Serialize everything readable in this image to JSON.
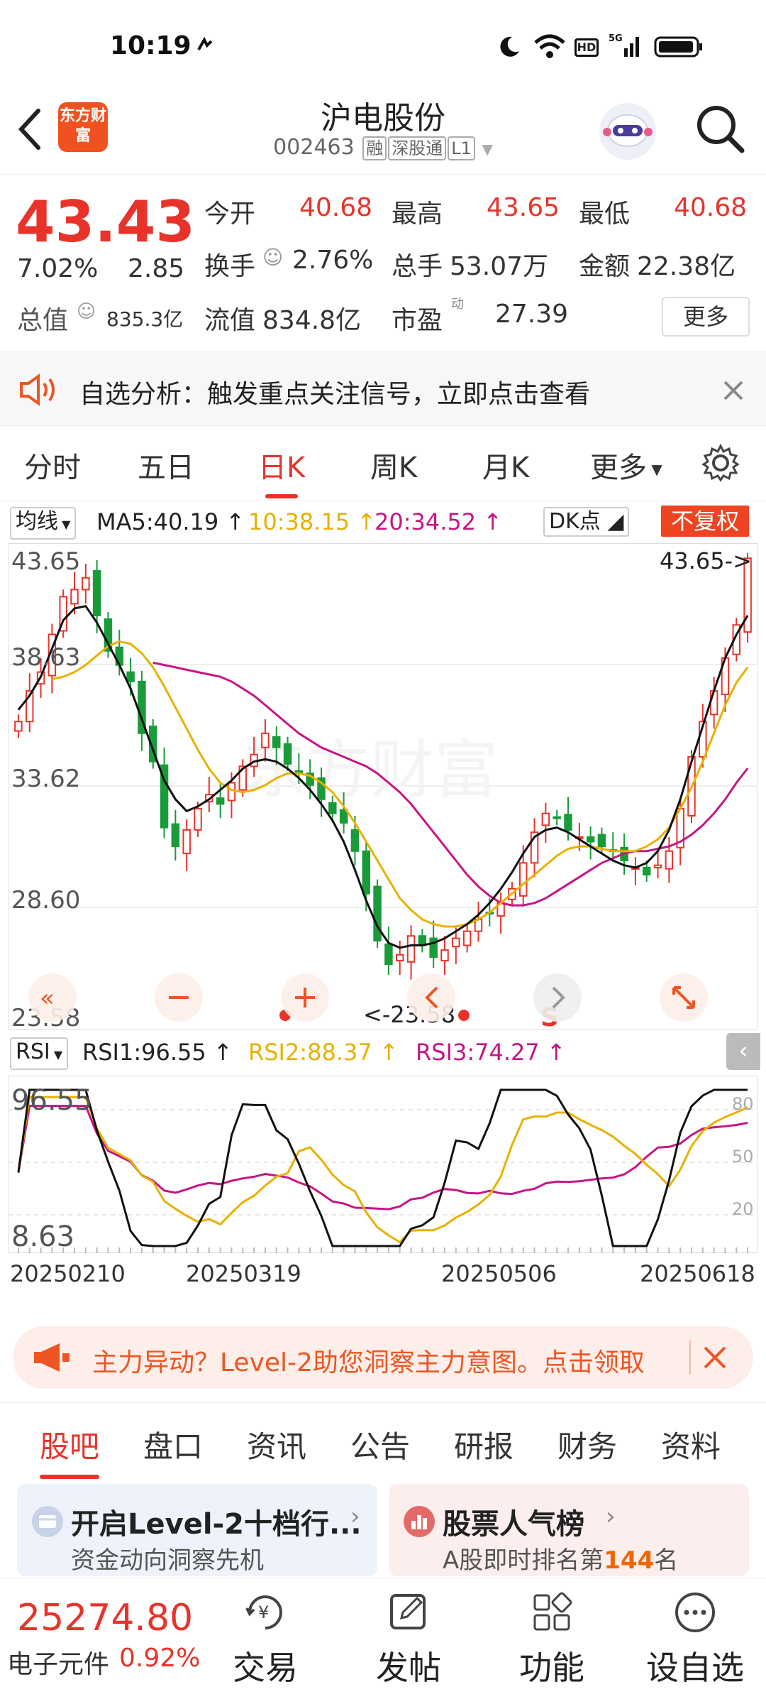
{
  "status_bar": {
    "time": "10:19"
  },
  "header": {
    "logo_text": "东方财富",
    "title": "沪电股份",
    "code": "002463",
    "tags": [
      "融",
      "深股通",
      "L1"
    ]
  },
  "quote": {
    "price": "43.43",
    "change_pct": "7.02%",
    "change_amt": "2.85",
    "open_label": "今开",
    "open": "40.68",
    "high_label": "最高",
    "high": "43.65",
    "low_label": "最低",
    "low": "40.68",
    "turnover_label": "换手",
    "turnover": "2.76%",
    "volume_label": "总手",
    "volume": "53.07万",
    "amount_label": "金额",
    "amount": "22.38亿",
    "mktcap_label": "总值",
    "mktcap": "835.3亿",
    "float_label": "流值",
    "float": "834.8亿",
    "pe_label": "市盈",
    "pe_sup": "动",
    "pe": "27.39",
    "more_label": "更多"
  },
  "notice": {
    "text": "自选分析：触发重点关注信号，立即点击查看"
  },
  "period_tabs": [
    "分时",
    "五日",
    "日K",
    "周K",
    "月K",
    "更多"
  ],
  "active_period": "日K",
  "ma_row": {
    "selector": "均线",
    "ma5": "MA5:40.19",
    "ma10": "10:38.15",
    "ma20": "20:34.52",
    "dk": "DK点",
    "adjust": "不复权"
  },
  "kchart": {
    "y_labels": [
      "43.65",
      "38.63",
      "33.62",
      "28.60",
      "23.58"
    ],
    "max_label": "43.65->",
    "min_label": "<-23.58",
    "watermark": "东方财富",
    "s_marker": "S"
  },
  "rsi_row": {
    "selector": "RSI",
    "rsi1": "RSI1:96.55",
    "rsi2": "RSI2:88.37",
    "rsi3": "RSI3:74.27"
  },
  "rsichart": {
    "top_label": "96.55",
    "bottom_label": "8.63",
    "levels": [
      "80",
      "50",
      "20"
    ]
  },
  "dates": [
    "20250210",
    "20250319",
    "20250506",
    "20250618"
  ],
  "banner": {
    "text": "主力异动？Level-2助您洞察主力意图。点击领取"
  },
  "bottom_tabs": [
    "股吧",
    "盘口",
    "资讯",
    "公告",
    "研报",
    "财务",
    "资料"
  ],
  "active_bottom_tab": "股吧",
  "cards": [
    {
      "title": "开启Level-2十档行...",
      "sub": "资金动向洞察先机"
    },
    {
      "title": "股票人气榜",
      "sub_prefix": "A股即时排名第",
      "rank": "144",
      "sub_suffix": "名"
    }
  ],
  "bottom_nav": {
    "index_value": "25274.80",
    "index_name": "电子元件",
    "index_change": "0.92%",
    "items": [
      "交易",
      "发帖",
      "功能",
      "设自选"
    ]
  },
  "chart_data": {
    "type": "candlestick",
    "ylim": [
      23.58,
      43.65
    ],
    "close": [
      36.5,
      37.8,
      38.6,
      40.2,
      41.8,
      42.1,
      42.6,
      41.0,
      39.5,
      38.9,
      38.2,
      36.0,
      34.8,
      32.0,
      31.2,
      31.9,
      32.8,
      33.4,
      33.0,
      33.9,
      34.6,
      35.1,
      36.0,
      35.4,
      34.7,
      34.3,
      33.8,
      33.2,
      32.6,
      32.2,
      31.0,
      29.2,
      27.2,
      26.2,
      26.6,
      27.4,
      27.0,
      26.5,
      26.8,
      27.3,
      27.6,
      28.1,
      28.4,
      28.8,
      29.4,
      30.5,
      31.8,
      32.6,
      32.4,
      31.9,
      31.6,
      31.4,
      31.2,
      31.0,
      30.6,
      30.3,
      30.0,
      30.4,
      31.0,
      32.8,
      35.0,
      36.5,
      37.8,
      39.2,
      40.6,
      43.43
    ],
    "ma5": [
      37.0,
      37.6,
      38.4,
      39.6,
      40.8,
      41.3,
      41.4,
      40.7,
      39.8,
      38.9,
      37.9,
      36.6,
      35.3,
      34.0,
      33.2,
      32.7,
      32.9,
      33.2,
      33.6,
      34.0,
      34.5,
      34.8,
      34.9,
      34.8,
      34.5,
      34.1,
      33.6,
      33.0,
      32.3,
      31.4,
      30.2,
      28.9,
      27.8,
      27.1,
      26.9,
      27.0,
      27.0,
      27.1,
      27.3,
      27.6,
      27.9,
      28.3,
      28.8,
      29.4,
      30.1,
      30.9,
      31.6,
      31.9,
      32.0,
      31.8,
      31.5,
      31.2,
      30.9,
      30.6,
      30.4,
      30.3,
      30.5,
      31.0,
      31.9,
      33.2,
      34.8,
      36.3,
      37.8,
      39.2,
      40.19,
      41.0
    ],
    "ma10": [
      38.3,
      38.4,
      38.6,
      38.9,
      39.3,
      39.7,
      39.9,
      39.8,
      39.4,
      38.8,
      38.0,
      37.1,
      36.2,
      35.3,
      34.5,
      33.9,
      33.6,
      33.5,
      33.6,
      33.8,
      34.1,
      34.3,
      34.3,
      34.2,
      33.9,
      33.5,
      32.9,
      32.2,
      31.4,
      30.6,
      29.8,
      29.0,
      28.5,
      28.1,
      27.9,
      27.8,
      27.8,
      27.9,
      28.1,
      28.4,
      28.8,
      29.2,
      29.6,
      30.0,
      30.4,
      30.8,
      31.1,
      31.2,
      31.2,
      31.1,
      31.0,
      31.0,
      31.0,
      31.2,
      31.5,
      32.0,
      32.8,
      33.7,
      34.8,
      36.0,
      37.2,
      38.15,
      38.8
    ],
    "ma20": [
      39.0,
      38.9,
      38.8,
      38.7,
      38.6,
      38.5,
      38.4,
      38.2,
      37.9,
      37.6,
      37.2,
      36.8,
      36.4,
      36.0,
      35.7,
      35.4,
      35.2,
      35.0,
      34.8,
      34.6,
      34.3,
      33.9,
      33.5,
      33.0,
      32.4,
      31.8,
      31.2,
      30.6,
      30.0,
      29.5,
      29.1,
      28.8,
      28.7,
      28.7,
      28.8,
      29.0,
      29.3,
      29.6,
      29.9,
      30.2,
      30.5,
      30.7,
      30.9,
      31.0,
      31.0,
      31.1,
      31.2,
      31.4,
      31.7,
      32.1,
      32.6,
      33.2,
      33.9,
      34.52
    ]
  }
}
